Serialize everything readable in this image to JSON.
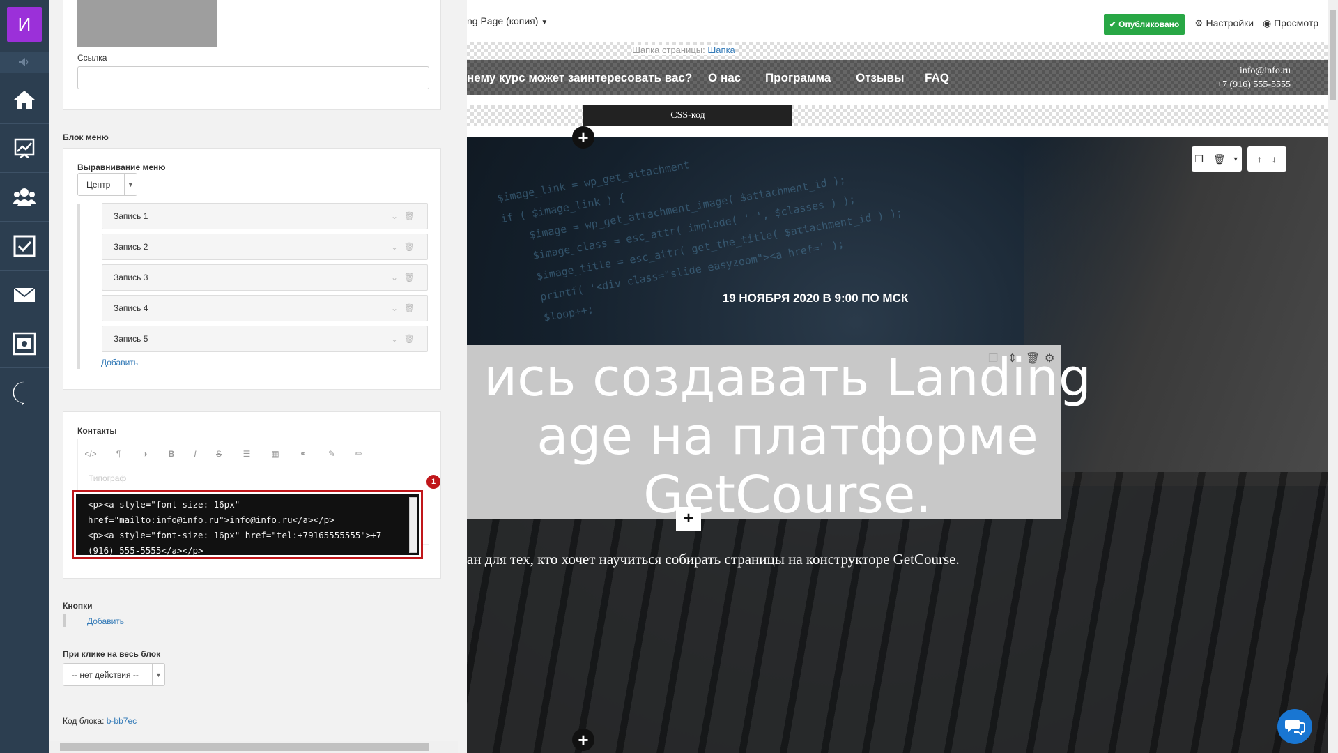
{
  "rail": {
    "avatar_letter": "И",
    "items": [
      "home-icon",
      "chart-icon",
      "users-icon",
      "tasks-icon",
      "mail-icon",
      "settings-box-icon",
      "getcourse-icon"
    ]
  },
  "panel": {
    "link_label": "Ссылка",
    "link_value": "",
    "menu_block_label": "Блок меню",
    "align_label": "Выравнивание меню",
    "align_value": "Центр",
    "items": [
      "Запись 1",
      "Запись 2",
      "Запись 3",
      "Запись 4",
      "Запись 5"
    ],
    "add_label": "Добавить",
    "contacts_label": "Контакты",
    "typograph_placeholder": "Типограф",
    "code_lines": [
      "<p><a style=\"font-size: 16px\"",
      "href=\"mailto:info@info.ru\">info@info.ru</a></p>",
      "<p><a style=\"font-size: 16px\" href=\"tel:+79165555555\">+7",
      "(916) 555-5555</a></p>"
    ],
    "badge": "1",
    "buttons_label": "Кнопки",
    "buttons_add": "Добавить",
    "click_label": "При клике на весь блок",
    "click_value": "-- нет действия --",
    "block_code_label": "Код блока:",
    "block_code_value": "b-bb7ec"
  },
  "preview": {
    "page_title": "ng Page (копия)",
    "published": "Опубликовано",
    "settings": "Настройки",
    "view": "Просмотр",
    "header_hint": "Шапка страницы:",
    "header_link": "Шапка",
    "menu": [
      "нему курс может заинтересовать вас?",
      "О нас",
      "Программа",
      "Отзывы",
      "FAQ"
    ],
    "email": "info@info.ru",
    "phone": "+7 (916) 555-5555",
    "css_code": "CSS-код",
    "date": "19 НОЯБРЯ 2020 В 9:00 ПО МСК",
    "title_lines": [
      "ись создавать Landing",
      "age на платформе",
      "GetCourse."
    ],
    "subtitle": "ан для тех, кто хочет научиться собирать страницы на конструкторе GetCourse."
  },
  "colors": {
    "rail_bg": "#2c3e50",
    "avatar": "#9b30d9",
    "published": "#28a745",
    "highlight": "#c0161a",
    "link": "#337ab7"
  }
}
